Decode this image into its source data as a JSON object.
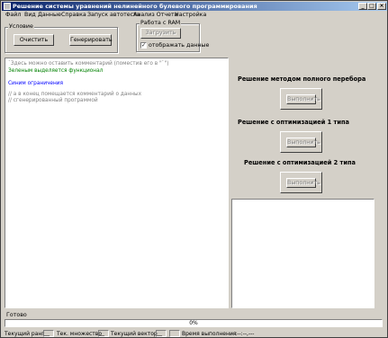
{
  "window": {
    "title": "Решение системы уравнений нелинейного булевого программирования",
    "minimize": "_",
    "maximize": "□",
    "close": "×"
  },
  "menu": [
    "Файл",
    "Вид",
    "Данные",
    "Справка",
    "Запуск автотеста",
    "Анализ Отчета",
    "Настройка"
  ],
  "condition_group": {
    "label": "Условие",
    "clear_button": "Очистить",
    "generate_button": "Генерировать"
  },
  "ram_group": {
    "label": "Работа с RAM",
    "load_button": "Загрузить",
    "show_data_label": "отображать данные",
    "show_data_checked": true
  },
  "editor": {
    "lines": [
      {
        "text": "`Здесь можно оставить комментарий (поместив его в \"`\")",
        "color": "#808080"
      },
      {
        "text": "Зеленым выделяется функционал",
        "color": "#008000"
      },
      {
        "text": "",
        "color": "#000000"
      },
      {
        "text": "Синим ограничения",
        "color": "#0000ff"
      },
      {
        "text": "",
        "color": "#000000"
      },
      {
        "text": "// а в конец помещается комментарий о данных",
        "color": "#808080"
      },
      {
        "text": "// сгенерированный программой",
        "color": "#808080"
      }
    ]
  },
  "solutions": {
    "full_search": {
      "heading": "Решение методом полного перебора",
      "button": "Выполнить"
    },
    "opt1": {
      "heading": "Решение с оптимизацией 1 типа",
      "button": "Выполнить"
    },
    "opt2": {
      "heading": "Решение с оптимизацией 2 типа",
      "button": "Выполнить"
    }
  },
  "status": {
    "ready": "Готово",
    "progress_percent": 0,
    "progress_text": "0%",
    "current_rank_label": "Текущий ранг",
    "current_rank_value": "__",
    "current_set_label": "Тек. множество",
    "current_set_value": "__",
    "current_vector_label": "Текущий вектор",
    "current_vector_value": "__",
    "time_label": "Время выполнения",
    "time_value": "--:--:--,---"
  }
}
